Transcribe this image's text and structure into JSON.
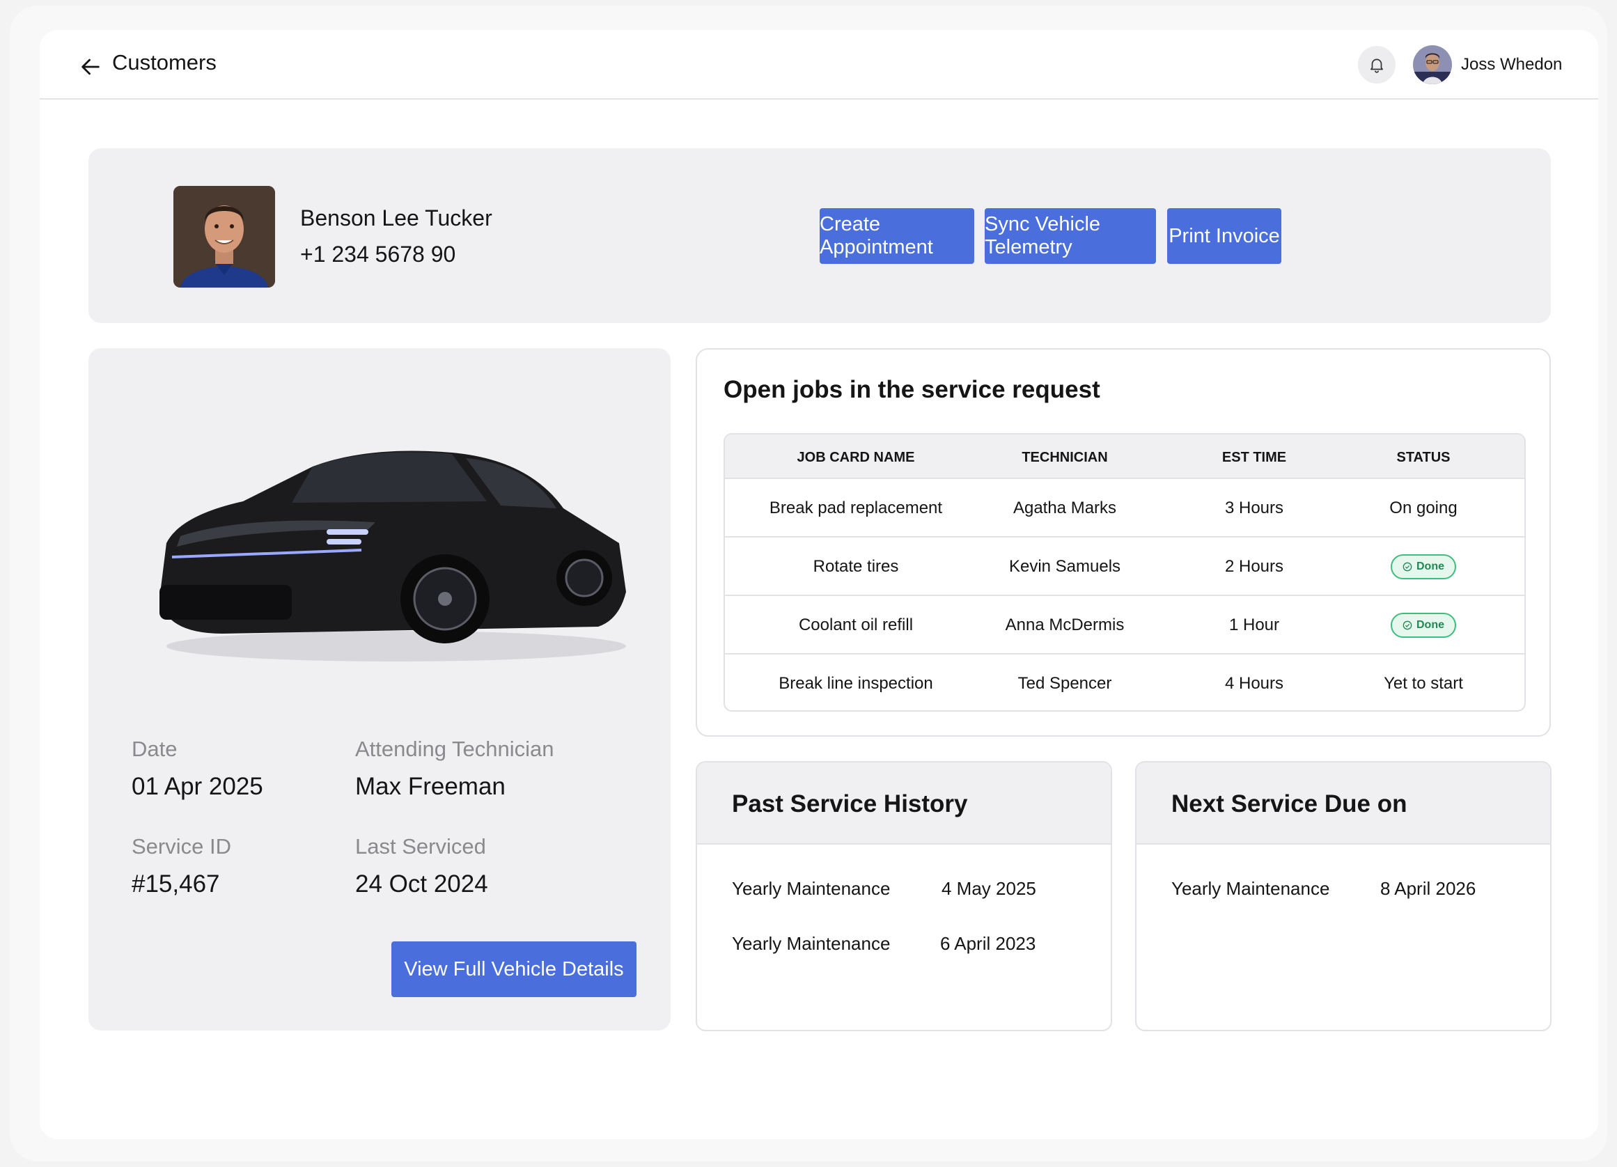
{
  "header": {
    "back_label": "Customers",
    "user_name": "Joss Whedon",
    "icons": {
      "back": "arrow-left-icon",
      "notifications": "bell-icon"
    }
  },
  "customer": {
    "name": "Benson Lee Tucker",
    "phone": "+1 234 5678 90",
    "actions": {
      "create_appointment": "Create Appointment",
      "sync_telemetry": "Sync Vehicle Telemetry",
      "print_invoice": "Print Invoice"
    }
  },
  "vehicle": {
    "date_label": "Date",
    "date_value": "01 Apr 2025",
    "technician_label": "Attending Technician",
    "technician_value": "Max Freeman",
    "service_id_label": "Service ID",
    "service_id_value": "#15,467",
    "last_serviced_label": "Last Serviced",
    "last_serviced_value": "24 Oct 2024",
    "details_button": "View Full Vehicle Details"
  },
  "jobs": {
    "title": "Open jobs in the service request",
    "columns": [
      "JOB CARD NAME",
      "TECHNICIAN",
      "EST TIME",
      "STATUS"
    ],
    "rows": [
      {
        "name": "Break pad replacement",
        "technician": "Agatha Marks",
        "time": "3 Hours",
        "status": "On going",
        "badge": false
      },
      {
        "name": "Rotate tires",
        "technician": "Kevin Samuels",
        "time": "2 Hours",
        "status": "Done",
        "badge": true
      },
      {
        "name": "Coolant oil refill",
        "technician": "Anna McDermis",
        "time": "1 Hour",
        "status": "Done",
        "badge": true
      },
      {
        "name": "Break line inspection",
        "technician": "Ted Spencer",
        "time": "4 Hours",
        "status": "Yet to start",
        "badge": false
      }
    ]
  },
  "past_history": {
    "title": "Past Service History",
    "items": [
      {
        "type": "Yearly Maintenance",
        "date": "4 May 2025"
      },
      {
        "type": "Yearly Maintenance",
        "date": "6 April 2023"
      }
    ]
  },
  "next_service": {
    "title": "Next Service Due on",
    "items": [
      {
        "type": "Yearly Maintenance",
        "date": "8 April 2026"
      }
    ]
  },
  "colors": {
    "accent": "#4a6fdc",
    "card_bg": "#f0f0f2",
    "done_green": "#3dbd7d"
  }
}
